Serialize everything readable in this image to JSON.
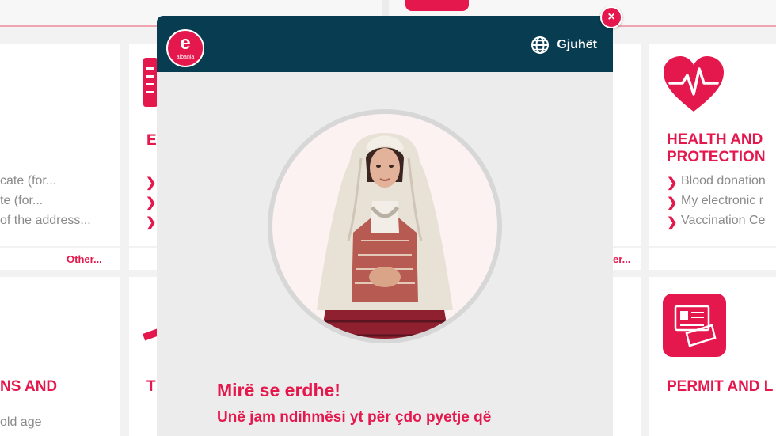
{
  "modal": {
    "logo": {
      "letter": "e",
      "subtext": "albania"
    },
    "language_label": "Gjuhët",
    "welcome": "Mirë se erdhe!",
    "intro": "Unë jam ndihmësi yt për çdo pyetje që",
    "close_label": "×",
    "icons": {
      "language": "globe-icon",
      "close": "close-icon"
    }
  },
  "background": {
    "left_card_items": [
      "cate (for...",
      "te (for...",
      "of the address..."
    ],
    "left_card_link": "Other...",
    "mid_card_title_partial": "E",
    "mid_card_link_partial": "er...",
    "health_card": {
      "title_line1": "HEALTH AND",
      "title_line2": "PROTECTION",
      "items": [
        "Blood donation",
        "My electronic r",
        "Vaccination Ce"
      ],
      "icon": "heart-pulse-icon"
    },
    "bottom_left_title": "NS AND",
    "bottom_left_item": "old age",
    "bottom_mid_title": "T",
    "bottom_right_title": "PERMIT AND L",
    "bottom_right_icon": "permit-card-icon"
  },
  "colors": {
    "accent": "#e5184d",
    "header": "#083c50"
  }
}
